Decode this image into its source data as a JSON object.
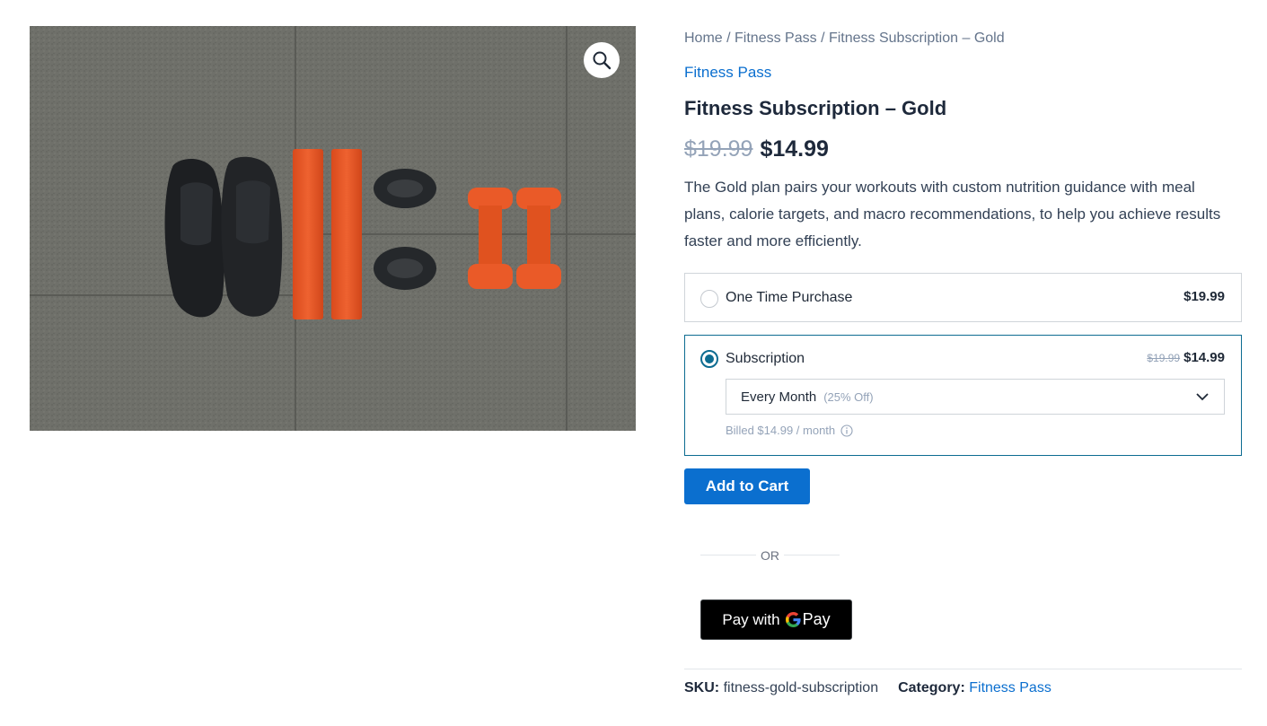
{
  "gallery": {
    "image_alt": "Fitness gear flat lay: black sneakers, orange resistance bands, jump ropes and orange dumbbells on a grey floor",
    "zoom_icon": "magnifier-icon"
  },
  "breadcrumb": {
    "home": "Home",
    "sep": " / ",
    "category": "Fitness Pass",
    "current": "Fitness Subscription – Gold"
  },
  "product": {
    "category_link": "Fitness Pass",
    "title": "Fitness Subscription – Gold",
    "price_regular": "$19.99",
    "price_sale": "$14.99",
    "description": "The Gold plan pairs your workouts with custom nutrition guidance with meal plans, calorie targets, and macro recommendations, to help you achieve results faster and more efficiently."
  },
  "purchase_options": {
    "one_time": {
      "label": "One Time Purchase",
      "price": "$19.99",
      "selected": false
    },
    "subscription": {
      "label": "Subscription",
      "price_regular": "$19.99",
      "price_sale": "$14.99",
      "selected": true,
      "frequency_selected": "Every Month",
      "frequency_discount": "(25% Off)",
      "billed_text": "Billed $14.99 / month",
      "info_icon": "info-icon",
      "chevron_icon": "chevron-down-icon"
    }
  },
  "actions": {
    "add_to_cart": "Add to Cart",
    "or_text": "OR",
    "gpay_prefix": "Pay with",
    "gpay_brand": "Pay"
  },
  "meta": {
    "sku_label": "SKU:",
    "sku_value": "fitness-gold-subscription",
    "category_label": "Category:",
    "category_value": "Fitness Pass"
  },
  "colors": {
    "accent": "#0b6fcf",
    "selected_border": "#0d6c91",
    "heading": "#1e293b",
    "muted": "#94a3b8"
  }
}
